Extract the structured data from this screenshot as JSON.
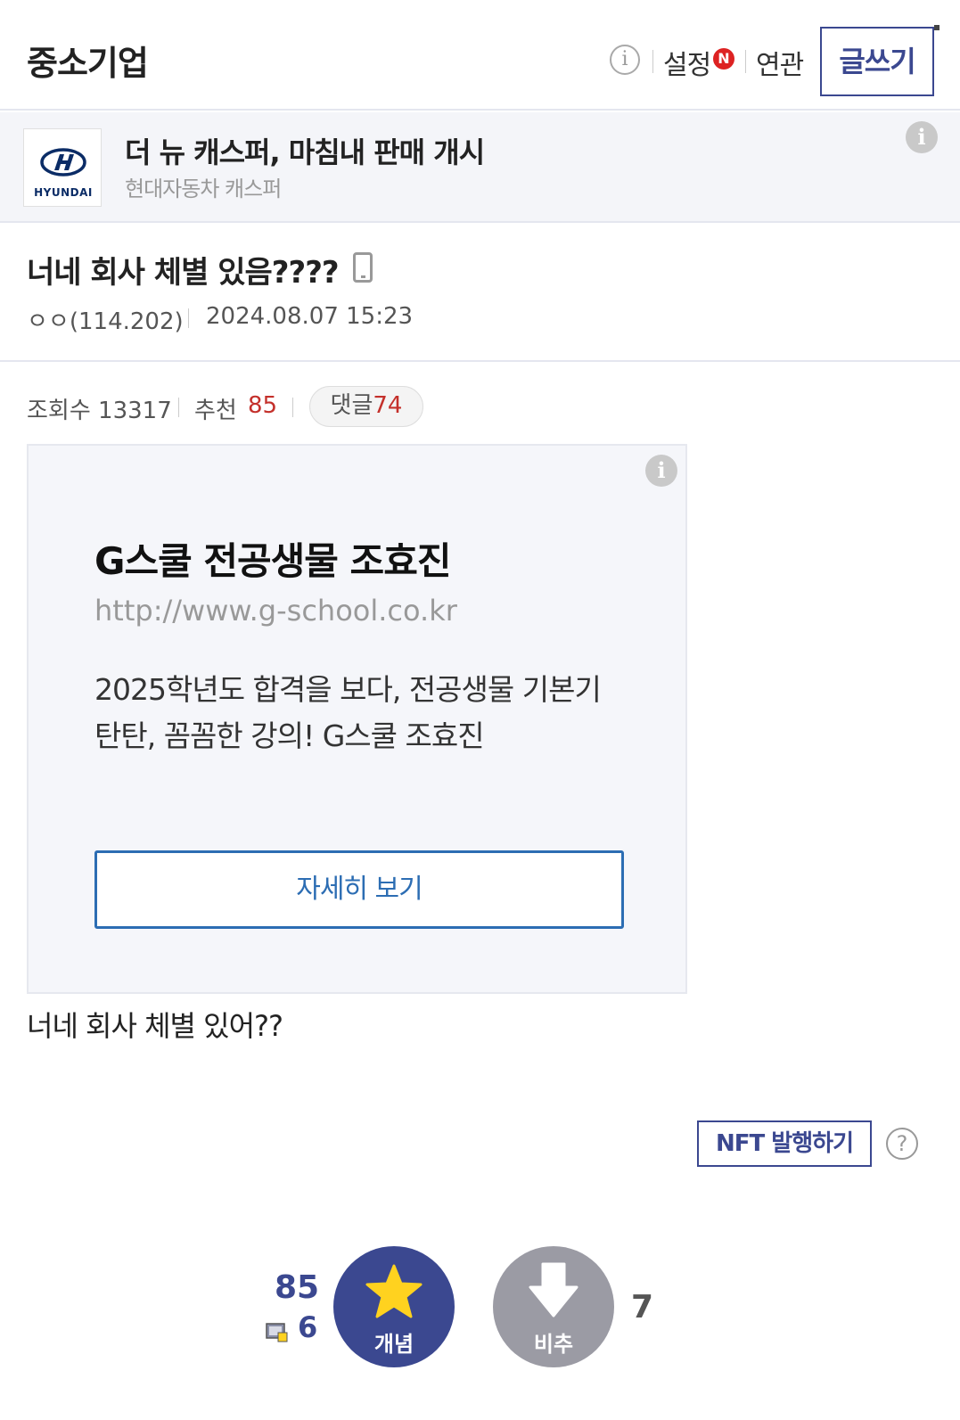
{
  "header": {
    "gallery_title": "중소기업",
    "info_icon": "info-icon",
    "settings_label": "설정",
    "settings_badge": "N",
    "related_label": "연관",
    "write_label": "글쓰기"
  },
  "banner": {
    "brand_name": "HYUNDAI",
    "title": "더 뉴 캐스퍼, 마침내 판매 개시",
    "subtitle": "현대자동차 캐스퍼",
    "info_icon": "info-icon"
  },
  "post": {
    "title": "너네 회사 체별 있음????",
    "device_icon": "mobile-icon",
    "author": "ㅇㅇ(114.202)",
    "date": "2024.08.07 15:23",
    "views_label": "조회수",
    "views": "13317",
    "recommend_label": "추천",
    "recommend": "85",
    "comments_label": "댓글",
    "comments": "74",
    "body": "너네 회사 체별 있어??"
  },
  "ad": {
    "title": "G스쿨 전공생물 조효진",
    "url": "http://www.g-school.co.kr",
    "description": "2025학년도 합격을 보다, 전공생물 기본기 탄탄, 꼼꼼한 강의! G스쿨 조효진",
    "cta": "자세히 보기"
  },
  "nft": {
    "label": "NFT 발행하기",
    "help": "?"
  },
  "votes": {
    "up_count": "85",
    "fixed_count": "6",
    "up_label": "개념",
    "down_label": "비추",
    "down_count": "7"
  },
  "colors": {
    "brand_navy": "#3b4890",
    "accent_red": "#c4302b",
    "star_yellow": "#ffd21f",
    "down_gray": "#9b9ba4",
    "link_blue": "#2c6db3"
  }
}
